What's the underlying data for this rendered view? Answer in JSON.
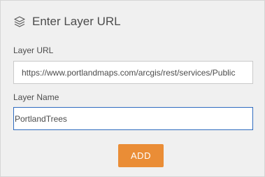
{
  "header": {
    "icon": "layers-icon",
    "title": "Enter Layer URL"
  },
  "layer_url": {
    "label": "Layer URL",
    "value": "https://www.portlandmaps.com/arcgis/rest/services/Public"
  },
  "layer_name": {
    "label": "Layer Name",
    "value": "PortlandTrees"
  },
  "actions": {
    "add_label": "ADD"
  },
  "colors": {
    "accent": "#ea8d36",
    "focus_border": "#2f6bbf",
    "panel_background": "#f0f0f0",
    "text": "#4c4c4c"
  }
}
